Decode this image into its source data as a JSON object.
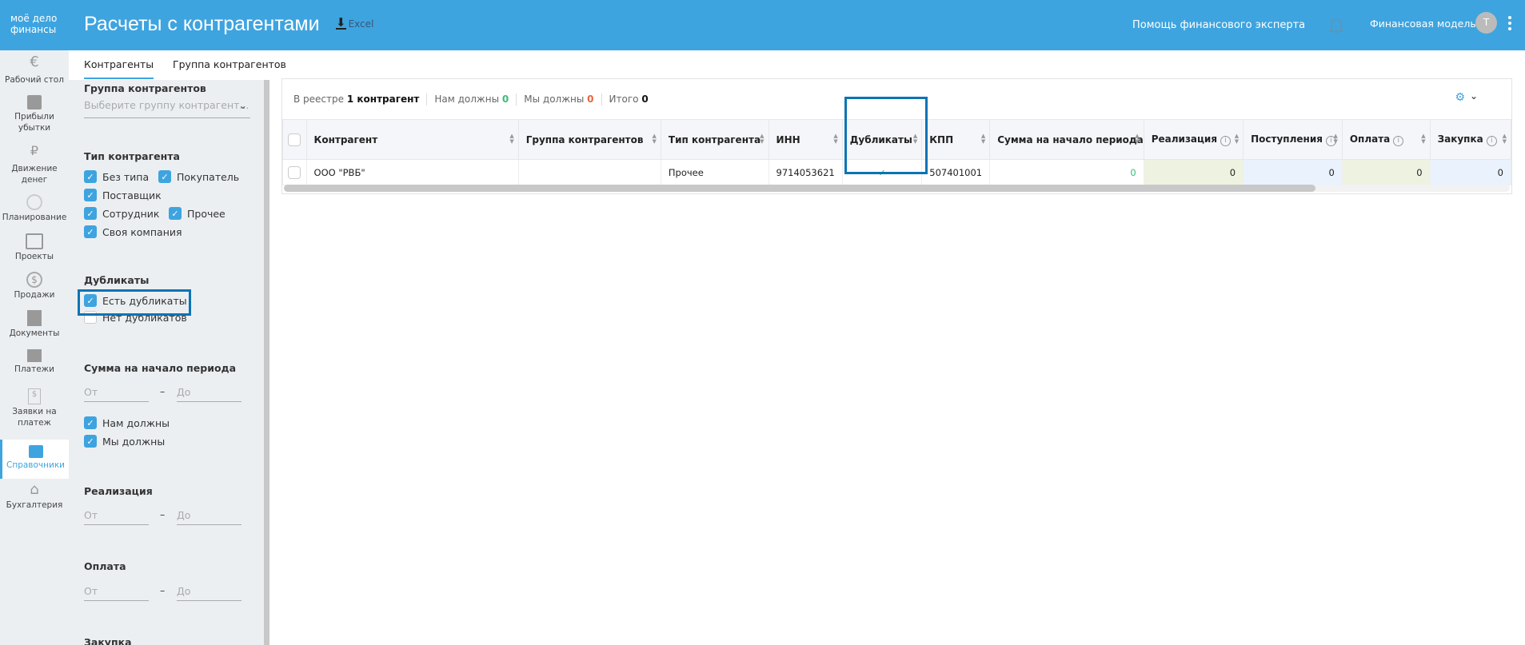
{
  "header": {
    "logo_line1": "моё дело",
    "logo_line2": "финансы",
    "title": "Расчеты с контрагентами",
    "excel": "Excel",
    "help": "Помощь финансового эксперта",
    "model": "Финансовая модель",
    "avatar": "Т"
  },
  "sidebar": {
    "items": [
      {
        "label": "Рабочий стол"
      },
      {
        "label": "Прибыли убытки"
      },
      {
        "label": "Движение денег"
      },
      {
        "label": "Планирование"
      },
      {
        "label": "Проекты"
      },
      {
        "label": "Продажи"
      },
      {
        "label": "Документы"
      },
      {
        "label": "Платежи"
      },
      {
        "label": "Заявки на платеж"
      },
      {
        "label": "Справочники"
      },
      {
        "label": "Бухгалтерия"
      }
    ]
  },
  "tabs": [
    {
      "label": "Контрагенты"
    },
    {
      "label": "Группа контрагентов"
    }
  ],
  "filters": {
    "group": {
      "title": "Группа контрагентов",
      "placeholder": "Выберите группу контрагент..."
    },
    "type": {
      "title": "Тип контрагента",
      "options": [
        {
          "label": "Без типа",
          "checked": true
        },
        {
          "label": "Покупатель",
          "checked": true
        },
        {
          "label": "Поставщик",
          "checked": true
        },
        {
          "label": "Сотрудник",
          "checked": true
        },
        {
          "label": "Прочее",
          "checked": true
        },
        {
          "label": "Своя компания",
          "checked": true
        }
      ]
    },
    "duplicates": {
      "title": "Дубликаты",
      "options": [
        {
          "label": "Есть дубликаты",
          "checked": true
        },
        {
          "label": "Нет дубликатов",
          "checked": false
        }
      ]
    },
    "start_sum": {
      "title": "Сумма на начало периода",
      "from": "От",
      "to": "До",
      "options": [
        {
          "label": "Нам должны",
          "checked": true
        },
        {
          "label": "Мы должны",
          "checked": true
        }
      ]
    },
    "sales": {
      "title": "Реализация",
      "from": "От",
      "to": "До"
    },
    "payment": {
      "title": "Оплата",
      "from": "От",
      "to": "До"
    },
    "purchase": {
      "title": "Закупка"
    },
    "dash": "–"
  },
  "summary": {
    "registry_label": "В реестре",
    "registry_value": "1 контрагент",
    "owed_to_us_label": "Нам должны",
    "owed_to_us": "0",
    "we_owe_label": "Мы должны",
    "we_owe": "0",
    "total_label": "Итого",
    "total": "0"
  },
  "colors": {
    "accent": "#3ea4df",
    "positive": "#3dbb7a",
    "negative": "#e8643c",
    "highlight": "#0b74b5"
  },
  "table": {
    "columns": [
      "Контрагент",
      "Группа контрагентов",
      "Тип контрагента",
      "ИНН",
      "Дубликаты",
      "КПП",
      "Сумма на начало периода",
      "Реализация",
      "Поступления",
      "Оплата",
      "Закупка"
    ],
    "rows": [
      {
        "name": "ООО \"РВБ\"",
        "group": "",
        "type": "Прочее",
        "inn": "9714053621",
        "duplicate": "✓",
        "kpp": "507401001",
        "start_sum": "0",
        "sales": "0",
        "receipts": "0",
        "payment": "0",
        "purchase": "0"
      }
    ]
  }
}
